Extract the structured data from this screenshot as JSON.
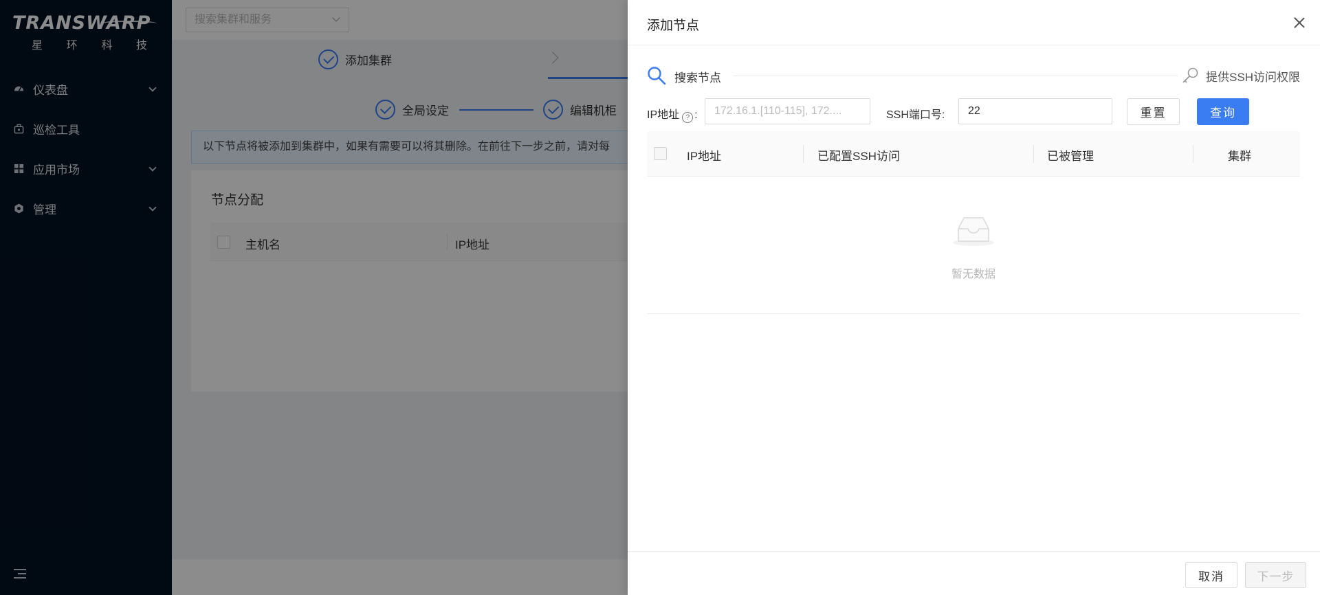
{
  "sidebar": {
    "logo_text": "TRANSWARP",
    "logo_sub": [
      "星",
      "环",
      "科",
      "技"
    ],
    "items": [
      {
        "label": "仪表盘",
        "icon": "dashboard-icon",
        "has_children": true
      },
      {
        "label": "巡检工具",
        "icon": "toolbox-icon",
        "has_children": false
      },
      {
        "label": "应用市场",
        "icon": "grid-icon",
        "has_children": true
      },
      {
        "label": "管理",
        "icon": "gear-icon",
        "has_children": true
      }
    ]
  },
  "topbar": {
    "search_placeholder": "搜索集群和服务"
  },
  "steps": {
    "current": "添加集群",
    "substeps": [
      "全局设定",
      "编辑机柜"
    ]
  },
  "alert_text": "以下节点将被添加到集群中，如果有需要可以将其删除。在前往下一步之前，请对每",
  "card": {
    "title": "节点分配",
    "columns": [
      "主机名",
      "IP地址"
    ]
  },
  "drawer": {
    "title": "添加节点",
    "search_label": "搜索节点",
    "ssh_link": "提供SSH访问权限",
    "filters": {
      "ip_label": "IP地址",
      "ip_placeholder": "172.16.1.[110-115], 172....",
      "ip_value": "",
      "port_label": "SSH端口号",
      "port_value": "22"
    },
    "buttons": {
      "reset": "重置",
      "query": "查询",
      "cancel": "取消",
      "next": "下一步"
    },
    "table": {
      "columns": [
        "IP地址",
        "已配置SSH访问",
        "已被管理",
        "集群"
      ],
      "empty_text": "暂无数据"
    }
  },
  "colors": {
    "sidebar_bg": "#031121",
    "primary": "#3a7cf2"
  }
}
